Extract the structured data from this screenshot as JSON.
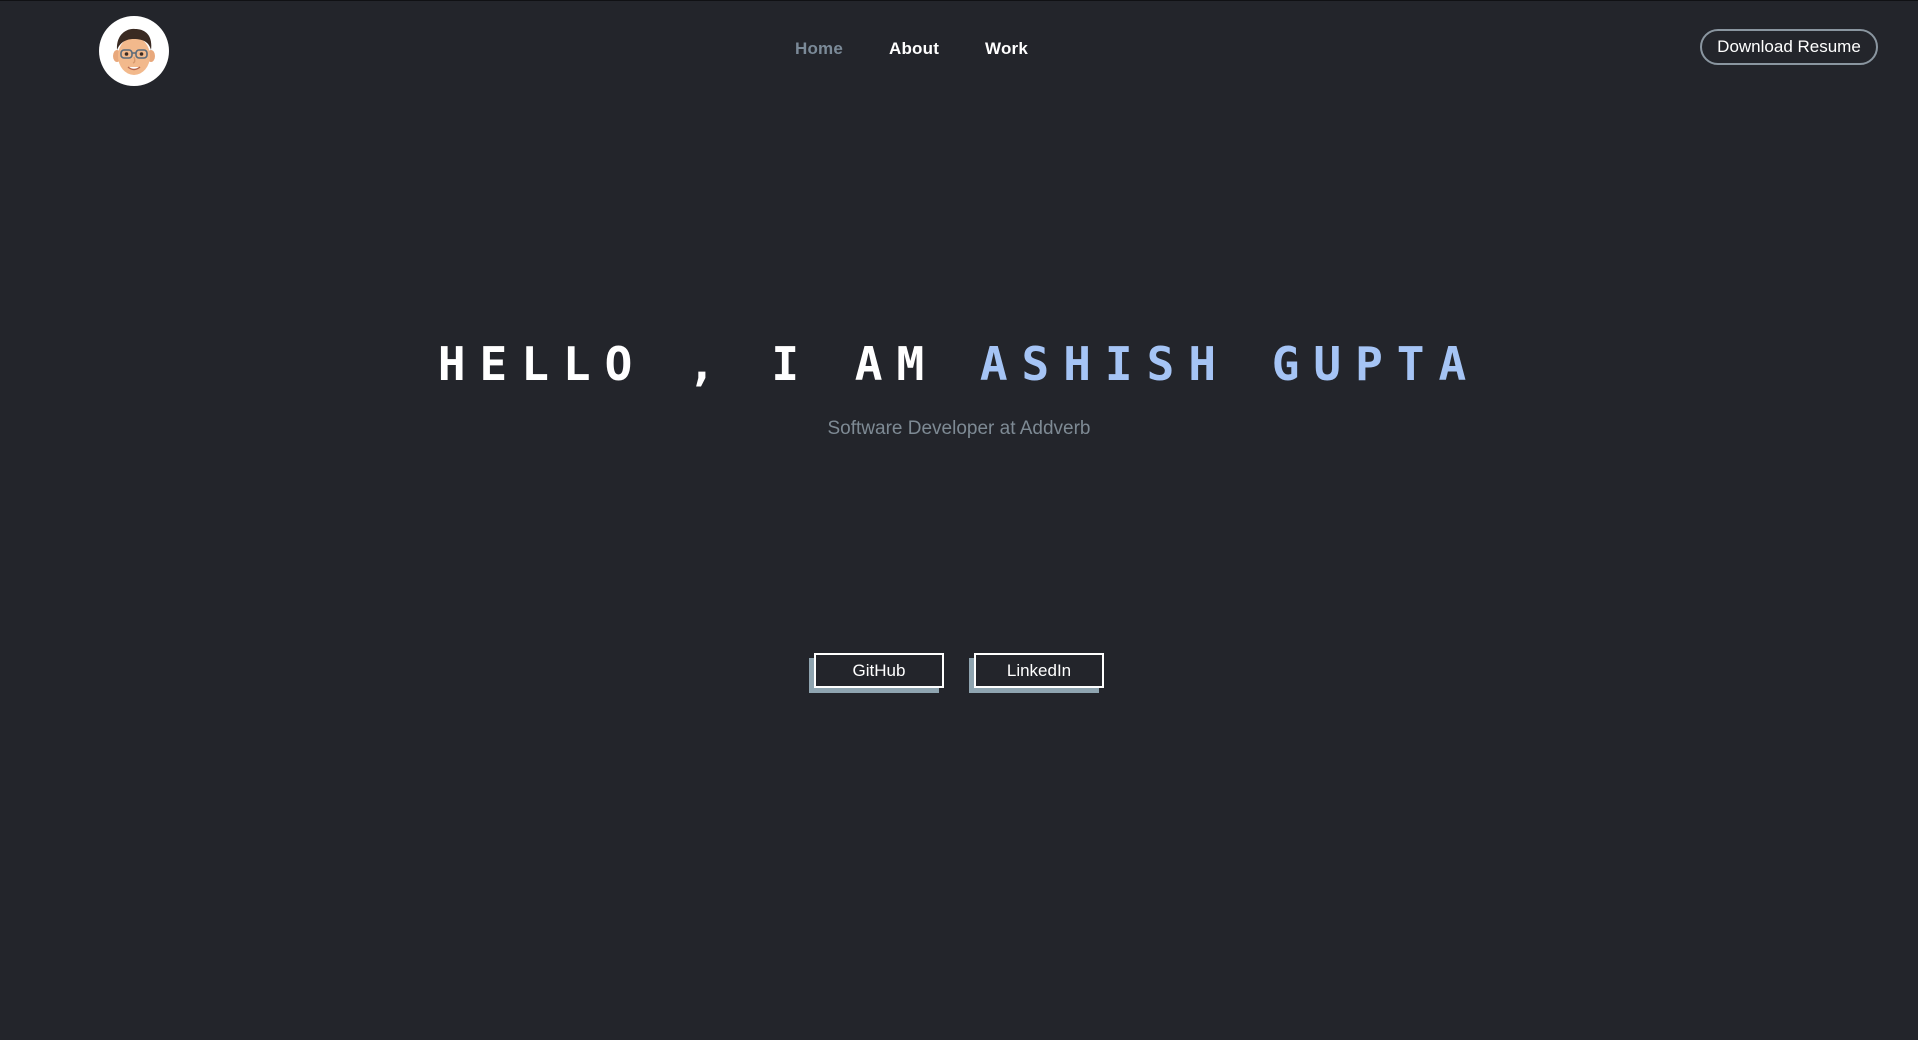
{
  "nav": {
    "links": [
      {
        "label": "Home",
        "active": true
      },
      {
        "label": "About",
        "active": false
      },
      {
        "label": "Work",
        "active": false
      }
    ],
    "resume_label": "Download Resume"
  },
  "hero": {
    "greeting": "HELLO , I AM ",
    "name": "ASHISH GUPTA",
    "subtitle": "Software Developer at Addverb"
  },
  "social": {
    "github_label": "GitHub",
    "linkedin_label": "LinkedIn"
  },
  "colors": {
    "background": "#23252b",
    "accent_name": "#a5c4f5",
    "muted_text": "#7e8a94",
    "button_shadow": "#8ea4b0"
  },
  "icons": {
    "avatar": "memoji-avatar-icon"
  }
}
